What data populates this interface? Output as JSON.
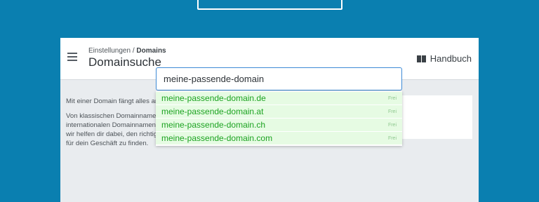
{
  "header": {
    "breadcrumb_parent": "Einstellungen",
    "breadcrumb_separator": " / ",
    "breadcrumb_current": "Domains",
    "title": "Domainsuche",
    "manual_label": "Handbuch"
  },
  "sidebar": {
    "intro": "Mit einer Domain fängt alles an.",
    "description": "Von klassischen Domainnamen wie .de zu internationalen Domainnamen wie .com – wir helfen dir dabei, den richtigen Namen für dein Geschäft zu finden."
  },
  "search": {
    "value": "meine-passende-domain"
  },
  "suggestions": [
    {
      "domain": "meine-passende-domain.de",
      "status": "Frei"
    },
    {
      "domain": "meine-passende-domain.at",
      "status": "Frei"
    },
    {
      "domain": "meine-passende-domain.ch",
      "status": "Frei"
    },
    {
      "domain": "meine-passende-domain.com",
      "status": "Frei"
    }
  ],
  "colors": {
    "background": "#0a7fb0",
    "available": "#1ca321",
    "focus": "#3d8ad6"
  },
  "icons": {
    "menu": "hamburger-menu-icon",
    "manual": "book-icon"
  }
}
